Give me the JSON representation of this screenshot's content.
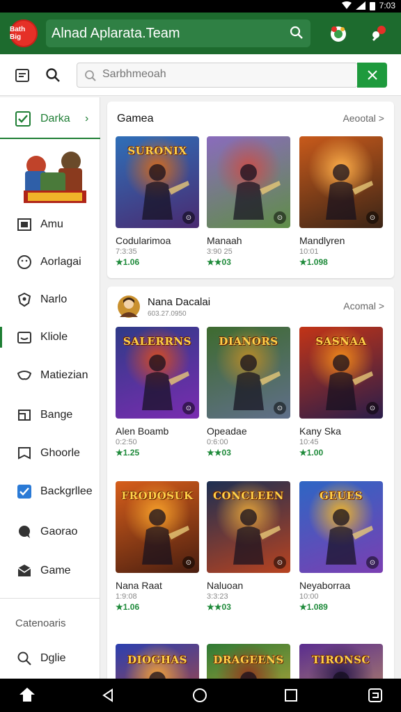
{
  "status_bar": {
    "time": "7:03"
  },
  "header": {
    "logo_text": "Bath Big",
    "title": "Alnad Aplarata.Team"
  },
  "search": {
    "placeholder": "Sarbhmeoah"
  },
  "sidebar": {
    "active": {
      "label": "Darka"
    },
    "items": [
      {
        "label": "Amu",
        "icon": "square-icon"
      },
      {
        "label": "Aorlagai",
        "icon": "face-icon"
      },
      {
        "label": "Narlo",
        "icon": "shield-icon"
      },
      {
        "label": "Kliole",
        "icon": "tray-icon"
      },
      {
        "label": "Matiezian",
        "icon": "mask-icon"
      },
      {
        "label": "Bange",
        "icon": "ticket-icon"
      },
      {
        "label": "Ghoorle",
        "icon": "bookmark-icon"
      },
      {
        "label": "Backgrllee",
        "icon": "checkbox-icon"
      },
      {
        "label": "Gaorao",
        "icon": "chat-icon"
      },
      {
        "label": "Game",
        "icon": "mail-icon"
      }
    ],
    "section_label": "Catenoaris",
    "bottom_item": {
      "label": "Dglie",
      "icon": "search-icon"
    }
  },
  "games_section": {
    "title": "Gamea",
    "more": "Aeootal >",
    "tiles": [
      {
        "name": "Codularimoa",
        "count": "7:3:35",
        "rating": "★1.06",
        "art": "SURONIX",
        "palette": [
          "#2f6fb8",
          "#4a2a70",
          "#d46a1c"
        ]
      },
      {
        "name": "Manaah",
        "count": "3:90 25",
        "rating": "★★03",
        "art": "",
        "palette": [
          "#8a6bbd",
          "#5f8e47",
          "#c7504a"
        ]
      },
      {
        "name": "Mandlyren",
        "count": "10:01",
        "rating": "★1.098",
        "art": "",
        "palette": [
          "#c85a1b",
          "#3a2416",
          "#ffb04a"
        ]
      }
    ]
  },
  "featured_section": {
    "avatar_title": "Nana Dacalai",
    "avatar_sub": "603.27.0950",
    "more": "Acomal >",
    "rows": [
      [
        {
          "name": "Alen Boamb",
          "count": "0:2:50",
          "rating": "★1.25",
          "art": "SALERRNS",
          "palette": [
            "#2f3b88",
            "#7a2cb0",
            "#d64c22"
          ]
        },
        {
          "name": "Opeadae",
          "count": "0:6:00",
          "rating": "★★03",
          "art": "DIANORS",
          "palette": [
            "#3e6b2f",
            "#606f8a",
            "#b88b2a"
          ]
        },
        {
          "name": "Kany Ska",
          "count": "10:45",
          "rating": "★1.00",
          "art": "SASNAA",
          "palette": [
            "#c23417",
            "#2a1d4a",
            "#f08a1a"
          ]
        }
      ],
      [
        {
          "name": "Nana Raat",
          "count": "1:9:08",
          "rating": "★1.06",
          "art": "FRODOSUK",
          "palette": [
            "#d65e1b",
            "#4a1e10",
            "#f7a12a"
          ]
        },
        {
          "name": "Naluoan",
          "count": "3:3:23",
          "rating": "★★03",
          "art": "CONCLEEN",
          "palette": [
            "#1d2f52",
            "#b84320",
            "#e2a23a"
          ]
        },
        {
          "name": "Neyaborraa",
          "count": "10:00",
          "rating": "★1.089",
          "art": "GEUES",
          "palette": [
            "#2e66c4",
            "#7b3fb2",
            "#f0b429"
          ]
        }
      ],
      [
        {
          "name": "",
          "count": "",
          "rating": "",
          "art": "DIOGHAS",
          "palette": [
            "#2b3fb0",
            "#d04a1e",
            "#f2a23a"
          ]
        },
        {
          "name": "",
          "count": "",
          "rating": "",
          "art": "DRAGEENS",
          "palette": [
            "#2f7a35",
            "#e0b33a",
            "#8f3a1e"
          ]
        },
        {
          "name": "",
          "count": "",
          "rating": "",
          "art": "TIRONSC",
          "palette": [
            "#5a2d8f",
            "#d0a35a",
            "#2a1a4a"
          ]
        }
      ]
    ]
  },
  "colors": {
    "brand_green": "#1d6b2e",
    "accent_green": "#1e9a3d",
    "rating_green": "#1e8a3a"
  }
}
